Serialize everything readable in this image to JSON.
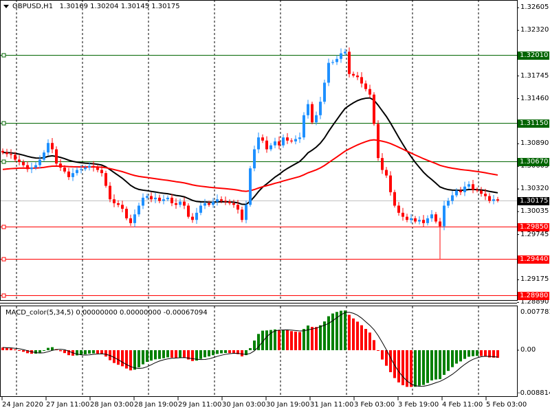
{
  "header": {
    "symbol": "GBPUSD,H1",
    "open": "1.30169",
    "high": "1.30204",
    "low": "1.30145",
    "close": "1.30175"
  },
  "macd_header": {
    "name": "MACD_color(5,34,5)",
    "v1": "0.00000000",
    "v2": "0.00000000",
    "v3": "-0.00067094"
  },
  "price_axis": [
    "1.32605",
    "1.32320",
    "1.31745",
    "1.31460",
    "1.30890",
    "1.30605",
    "1.30320",
    "1.30035",
    "1.29745",
    "1.29175",
    "1.28890"
  ],
  "levels": [
    {
      "price": "1.32010",
      "color": "#006400"
    },
    {
      "price": "1.31150",
      "color": "#006400"
    },
    {
      "price": "1.30670",
      "color": "#006400"
    },
    {
      "price": "1.29850",
      "color": "#ff0000"
    },
    {
      "price": "1.29440",
      "color": "#ff0000"
    },
    {
      "price": "1.28980",
      "color": "#ff0000"
    }
  ],
  "current_price": "1.30175",
  "macd_axis": {
    "top": "0.0077812",
    "zero": "0.00",
    "bottom": "-0.008814"
  },
  "time_axis": [
    "24 Jan 2020",
    "27 Jan 11:00",
    "28 Jan 03:00",
    "28 Jan 19:00",
    "29 Jan 11:00",
    "30 Jan 03:00",
    "30 Jan 19:00",
    "31 Jan 11:00",
    "3 Feb 03:00",
    "3 Feb 19:00",
    "4 Feb 11:00",
    "5 Feb 03:00"
  ],
  "colors": {
    "bull": "#1e90ff",
    "bear": "#ff0000",
    "macd_up": "#008000",
    "macd_down": "#ff0000",
    "ma_fast": "#000000",
    "ma_slow": "#ff0000"
  },
  "chart_data": {
    "type": "candlestick",
    "symbol": "GBPUSD",
    "timeframe": "H1",
    "first_open": 1.308,
    "closes": [
      1.3078,
      1.3076,
      1.3075,
      1.3069,
      1.3066,
      1.3062,
      1.3057,
      1.3059,
      1.3062,
      1.3069,
      1.3078,
      1.309,
      1.3082,
      1.3064,
      1.3059,
      1.3054,
      1.3047,
      1.3052,
      1.3056,
      1.3057,
      1.3059,
      1.3061,
      1.3059,
      1.3056,
      1.3052,
      1.3036,
      1.3019,
      1.3014,
      1.3012,
      1.3007,
      1.2995,
      1.2989,
      1.3,
      1.3011,
      1.3021,
      1.3023,
      1.3019,
      1.3021,
      1.3017,
      1.3019,
      1.3021,
      1.3014,
      1.3012,
      1.3016,
      1.3011,
      1.2997,
      1.2993,
      1.3002,
      1.3011,
      1.3014,
      1.3012,
      1.3016,
      1.3019,
      1.3017,
      1.3016,
      1.3014,
      1.3012,
      1.3006,
      1.2993,
      1.3012,
      1.3058,
      1.3082,
      1.3097,
      1.3093,
      1.3082,
      1.3087,
      1.3092,
      1.3087,
      1.3097,
      1.3093,
      1.3092,
      1.3095,
      1.3097,
      1.3125,
      1.3139,
      1.3116,
      1.3125,
      1.3142,
      1.3166,
      1.3191,
      1.3192,
      1.3196,
      1.3203,
      1.3205,
      1.3177,
      1.3175,
      1.3173,
      1.3165,
      1.3158,
      1.3151,
      1.3114,
      1.3071,
      1.3056,
      1.3049,
      1.3028,
      1.3011,
      1.3002,
      1.2997,
      1.2993,
      1.2995,
      1.2991,
      1.2993,
      1.2989,
      1.2995,
      1.3,
      1.2991,
      1.2985,
      1.3011,
      1.3017,
      1.3024,
      1.303,
      1.3028,
      1.3035,
      1.3038,
      1.3031,
      1.303,
      1.3026,
      1.3023,
      1.3017,
      1.3019,
      1.30175
    ],
    "low_overrides": {
      "106": 1.2944
    },
    "y_range": [
      1.2885,
      1.32703
    ],
    "macd_range": [
      -0.008814,
      0.0077812
    ]
  }
}
